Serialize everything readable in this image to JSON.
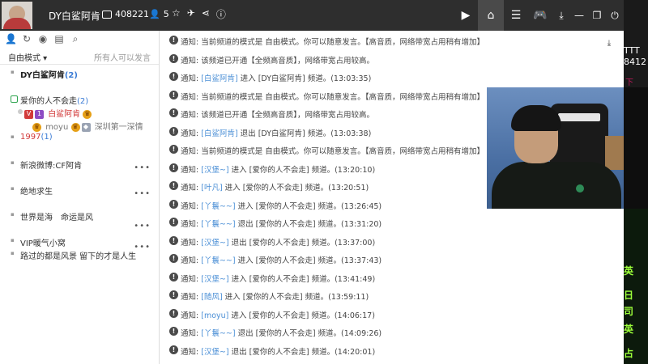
{
  "titlebar": {
    "channel_name": "DY白鲨阿肯",
    "channel_id": "408221",
    "online_count": "5"
  },
  "sidebar": {
    "mode_label": "自由模式",
    "mode_hint": "所有人可以发言",
    "channels": {
      "main": {
        "name": "DY白鲨阿肯",
        "count": "(2)"
      },
      "love": {
        "name": "爱你的人不会走",
        "count": "(2)"
      },
      "love_user1": {
        "badge_v": "V",
        "badge_level": "1",
        "name": "白鲨阿肯"
      },
      "love_user2": {
        "name": "moyu",
        "sub": "深圳第一深情"
      },
      "y1997": {
        "name": "1997",
        "count": "(1)"
      },
      "bowen": {
        "name": "新浪微博:CF阿肯"
      },
      "pubg": {
        "name": "绝地求生"
      },
      "sea": {
        "name": "世界是海　命运是风"
      },
      "vip": {
        "name": "VIP暖气小窝"
      },
      "path": {
        "name": "路过的都是风景 留下的才是人生"
      }
    }
  },
  "messages": [
    {
      "prefix": "通知:",
      "text": "当前频道的模式是 自由模式。你可以随意发言。【高音质，网络带宽占用稍有增加】"
    },
    {
      "prefix": "通知:",
      "text": "该频道已开通【全频高音质】，网络带宽占用较高。"
    },
    {
      "prefix": "通知:",
      "name": "[白鲨阿肯]",
      "text": " 进入 [DY白鲨阿肯] 频道。(13:03:35)"
    },
    {
      "prefix": "通知:",
      "text": "当前频道的模式是 自由模式。你可以随意发言。【高音质，网络带宽占用稍有增加】"
    },
    {
      "prefix": "通知:",
      "text": "该频道已开通【全频高音质】，网络带宽占用较高。"
    },
    {
      "prefix": "通知:",
      "name": "[白鲨阿肯]",
      "text": " 退出 [DY白鲨阿肯] 频道。(13:03:38)"
    },
    {
      "prefix": "通知:",
      "text": "当前频道的模式是 自由模式。你可以随意发言。【高音质，网络带宽占用稍有增加】"
    },
    {
      "prefix": "通知:",
      "name": "[汉堡~]",
      "text": " 进入 [爱你的人不会走] 频道。(13:20:10)"
    },
    {
      "prefix": "通知:",
      "name": "[叶凡]",
      "text": " 进入 [爱你的人不会走] 频道。(13:20:51)"
    },
    {
      "prefix": "通知:",
      "name": "[丫鬟~~]",
      "text": " 进入 [爱你的人不会走] 频道。(13:26:45)"
    },
    {
      "prefix": "通知:",
      "name": "[丫鬟~~]",
      "text": " 退出 [爱你的人不会走] 频道。(13:31:20)"
    },
    {
      "prefix": "通知:",
      "name": "[汉堡~]",
      "text": " 退出 [爱你的人不会走] 频道。(13:37:00)"
    },
    {
      "prefix": "通知:",
      "name": "[丫鬟~~]",
      "text": " 进入 [爱你的人不会走] 频道。(13:37:43)"
    },
    {
      "prefix": "通知:",
      "name": "[汉堡~]",
      "text": " 进入 [爱你的人不会走] 频道。(13:41:49)"
    },
    {
      "prefix": "通知:",
      "name": "[随风]",
      "text": " 进入 [爱你的人不会走] 频道。(13:59:11)"
    },
    {
      "prefix": "通知:",
      "name": "[moyu]",
      "text": " 进入 [爱你的人不会走] 频道。(14:06:17)"
    },
    {
      "prefix": "通知:",
      "name": "[丫鬟~~]",
      "text": " 退出 [爱你的人不会走] 频道。(14:09:26)"
    },
    {
      "prefix": "通知:",
      "name": "[汉堡~]",
      "text": " 退出 [爱你的人不会走] 频道。(14:20:01)"
    }
  ],
  "overlay": {
    "edge_t1": "TTT",
    "edge_t2": "8412",
    "edge_t3": "下",
    "edge_g1": "英",
    "edge_g2": "日",
    "edge_g3": "司",
    "edge_g4": "英",
    "edge_g5": "占"
  },
  "colors": {
    "titlebar_bg": "#2e2e2e",
    "link_blue": "#4b8fd6",
    "vip_red": "#d23a3a"
  }
}
